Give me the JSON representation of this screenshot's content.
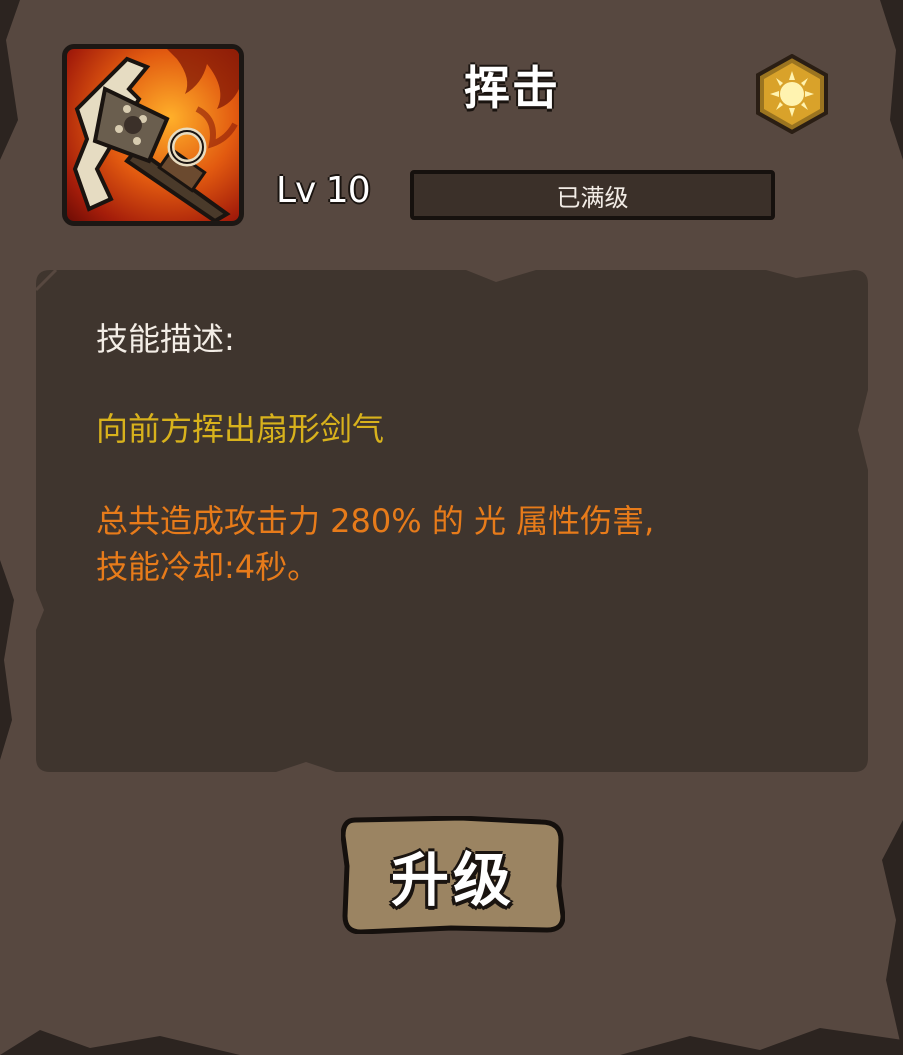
{
  "skill": {
    "title": "挥击",
    "icon": "axe-icon",
    "element_icon": "sun-icon",
    "level_label": "Lv 10",
    "level_status": "已满级",
    "level_progress": 1.0
  },
  "description": {
    "heading": "技能描述:",
    "effect": "向前方挥出扇形剑气",
    "damage": "总共造成攻击力 280% 的 光 属性伤害,",
    "cooldown": "技能冷却:4秒。"
  },
  "actions": {
    "upgrade_label": "升级"
  },
  "colors": {
    "panel_bg": "#574840",
    "desc_bg": "#3f352e",
    "effect_text": "#d8b21c",
    "damage_text": "#e77b1a",
    "button_bg": "#9b8462"
  }
}
